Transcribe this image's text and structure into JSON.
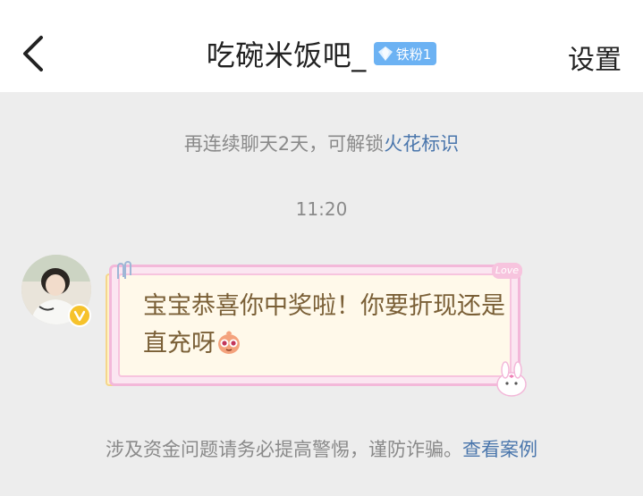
{
  "header": {
    "title": "吃碗米饭吧_",
    "badge_label": "铁粉1",
    "settings_label": "设置"
  },
  "notice": {
    "prefix": "再连续聊天2天，可解锁",
    "link": "火花标识"
  },
  "timestamp": "11:20",
  "message": {
    "text": "宝宝恭喜你中奖啦！你要折现还是直充呀",
    "decoration_tag": "Love"
  },
  "warning": {
    "prefix": "涉及资金问题请务必提高警惕，谨防诈骗。",
    "link": "查看案例"
  },
  "colors": {
    "link": "#4a76ac",
    "badge": "#6cb2f3",
    "background": "#ededed",
    "verified": "#f6c22b"
  },
  "icons": {
    "back": "chevron-left-icon",
    "badge": "diamond-icon",
    "verified": "verified-v-icon",
    "emoji": "cute-creature-emoji-icon"
  }
}
